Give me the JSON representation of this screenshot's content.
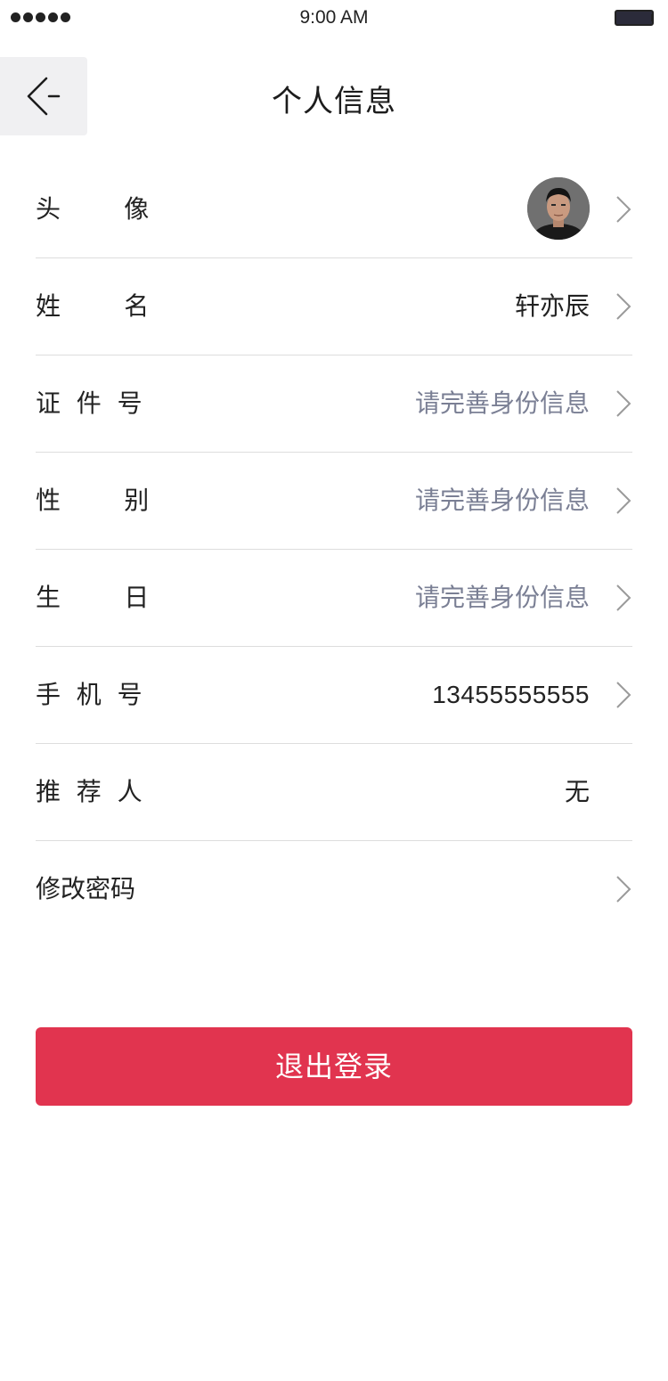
{
  "status_bar": {
    "time": "9:00 AM"
  },
  "nav": {
    "title": "个人信息",
    "back_icon": "back-arrow-icon"
  },
  "rows": [
    {
      "label": "头        像",
      "value": "",
      "has_avatar": true,
      "value_style": "normal",
      "chevron": true
    },
    {
      "label": "姓        名",
      "value": "轩亦辰",
      "value_style": "normal",
      "chevron": true
    },
    {
      "label": "证  件  号",
      "value": "请完善身份信息",
      "value_style": "muted",
      "chevron": true
    },
    {
      "label": "性        别",
      "value": "请完善身份信息",
      "value_style": "muted",
      "chevron": true
    },
    {
      "label": "生        日",
      "value": "请完善身份信息",
      "value_style": "muted",
      "chevron": true
    },
    {
      "label": "手  机  号",
      "value": "13455555555",
      "value_style": "normal",
      "chevron": true
    },
    {
      "label": "推  荐  人",
      "value": "无",
      "value_style": "normal",
      "chevron": false
    },
    {
      "label": "修改密码",
      "value": "",
      "value_style": "normal",
      "chevron": true
    }
  ],
  "logout": {
    "label": "退出登录"
  },
  "colors": {
    "accent": "#e1344f",
    "muted_text": "#7a7f94",
    "divider": "#dddddd"
  }
}
